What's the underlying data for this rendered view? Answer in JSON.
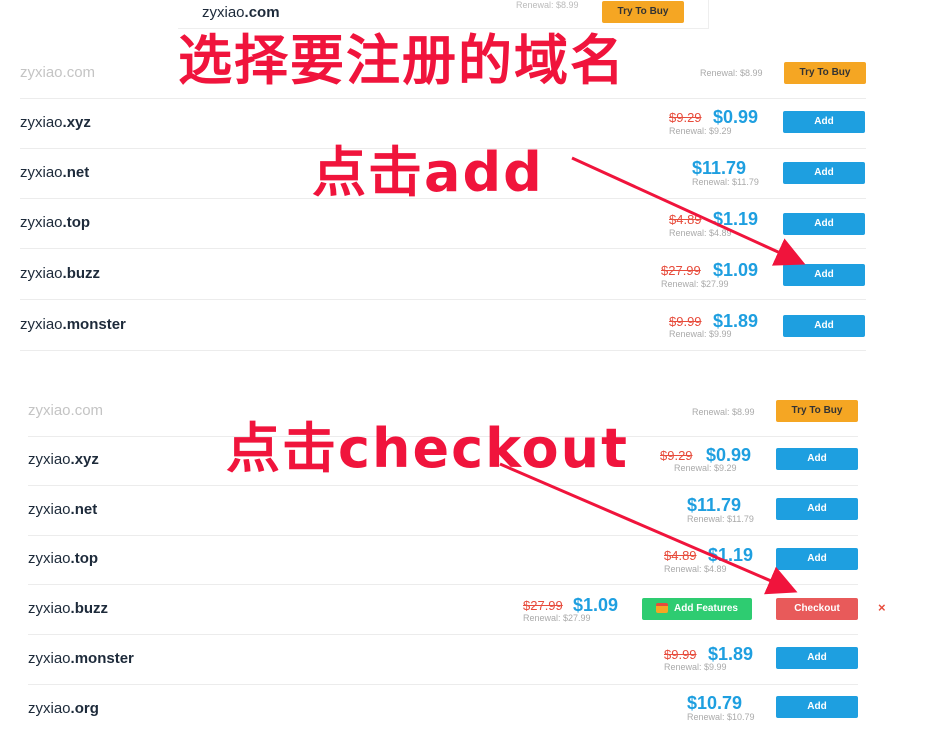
{
  "top_card": {
    "domain_base": "zyxiao",
    "domain_tld": ".com",
    "renewal": "Renewal: $8.99",
    "button": "Try To Buy"
  },
  "annotations": {
    "select_domain": "选择要注册的域名",
    "click_add": "点击add",
    "click_checkout": "点击checkout"
  },
  "section1": {
    "rows": [
      {
        "base": "zyxiao",
        "tld": ".com",
        "old": "",
        "price": "",
        "renewal": "Renewal: $8.99",
        "button": "Try To Buy"
      },
      {
        "base": "zyxiao",
        "tld": ".xyz",
        "old": "$9.29",
        "price": "$0.99",
        "renewal": "Renewal: $9.29",
        "button": "Add"
      },
      {
        "base": "zyxiao",
        "tld": ".net",
        "old": "",
        "price": "$11.79",
        "renewal": "Renewal: $11.79",
        "button": "Add"
      },
      {
        "base": "zyxiao",
        "tld": ".top",
        "old": "$4.89",
        "price": "$1.19",
        "renewal": "Renewal: $4.89",
        "button": "Add"
      },
      {
        "base": "zyxiao",
        "tld": ".buzz",
        "old": "$27.99",
        "price": "$1.09",
        "renewal": "Renewal: $27.99",
        "button": "Add"
      },
      {
        "base": "zyxiao",
        "tld": ".monster",
        "old": "$9.99",
        "price": "$1.89",
        "renewal": "Renewal: $9.99",
        "button": "Add"
      }
    ]
  },
  "section2": {
    "rows": [
      {
        "base": "zyxiao",
        "tld": ".com",
        "old": "",
        "price": "",
        "renewal": "Renewal: $8.99",
        "button": "Try To Buy"
      },
      {
        "base": "zyxiao",
        "tld": ".xyz",
        "old": "$9.29",
        "price": "$0.99",
        "renewal": "Renewal: $9.29",
        "button": "Add"
      },
      {
        "base": "zyxiao",
        "tld": ".net",
        "old": "",
        "price": "$11.79",
        "renewal": "Renewal: $11.79",
        "button": "Add"
      },
      {
        "base": "zyxiao",
        "tld": ".top",
        "old": "$4.89",
        "price": "$1.19",
        "renewal": "Renewal: $4.89",
        "button": "Add"
      },
      {
        "base": "zyxiao",
        "tld": ".buzz",
        "old": "$27.99",
        "price": "$1.09",
        "renewal": "Renewal: $27.99",
        "button": "Checkout",
        "features_button": "Add Features",
        "remove": "×"
      },
      {
        "base": "zyxiao",
        "tld": ".monster",
        "old": "$9.99",
        "price": "$1.89",
        "renewal": "Renewal: $9.99",
        "button": "Add"
      },
      {
        "base": "zyxiao",
        "tld": ".org",
        "old": "",
        "price": "$10.79",
        "renewal": "Renewal: $10.79",
        "button": "Add"
      }
    ]
  },
  "colors": {
    "accent": "#1e9fe0",
    "try": "#f5a623",
    "checkout": "#e85a5a",
    "features": "#2ecc71",
    "annotation": "#f0143c",
    "strike": "#e74c3c"
  }
}
